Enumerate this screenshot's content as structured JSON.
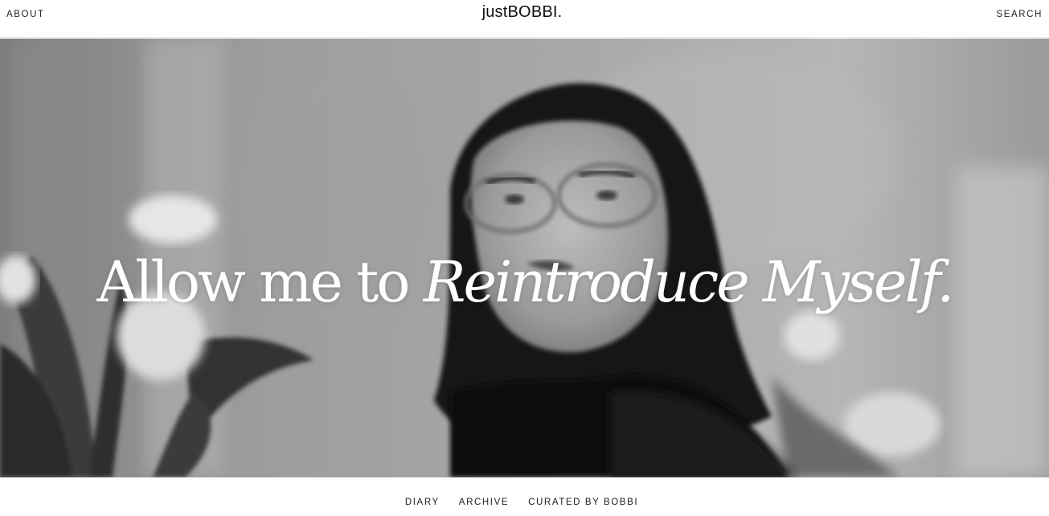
{
  "header": {
    "left_link": "ABOUT",
    "logo": "justBOBBI.",
    "right_link": "SEARCH"
  },
  "hero": {
    "headline_plain": "Allow me to ",
    "headline_italic": "Reintroduce Myself.",
    "image_style": "black-and-white photograph",
    "text_color": "#ffffff"
  },
  "footer_nav": {
    "items": [
      {
        "label": "DIARY"
      },
      {
        "label": "ARCHIVE"
      },
      {
        "label": "CURATED BY BOBBI"
      }
    ]
  }
}
